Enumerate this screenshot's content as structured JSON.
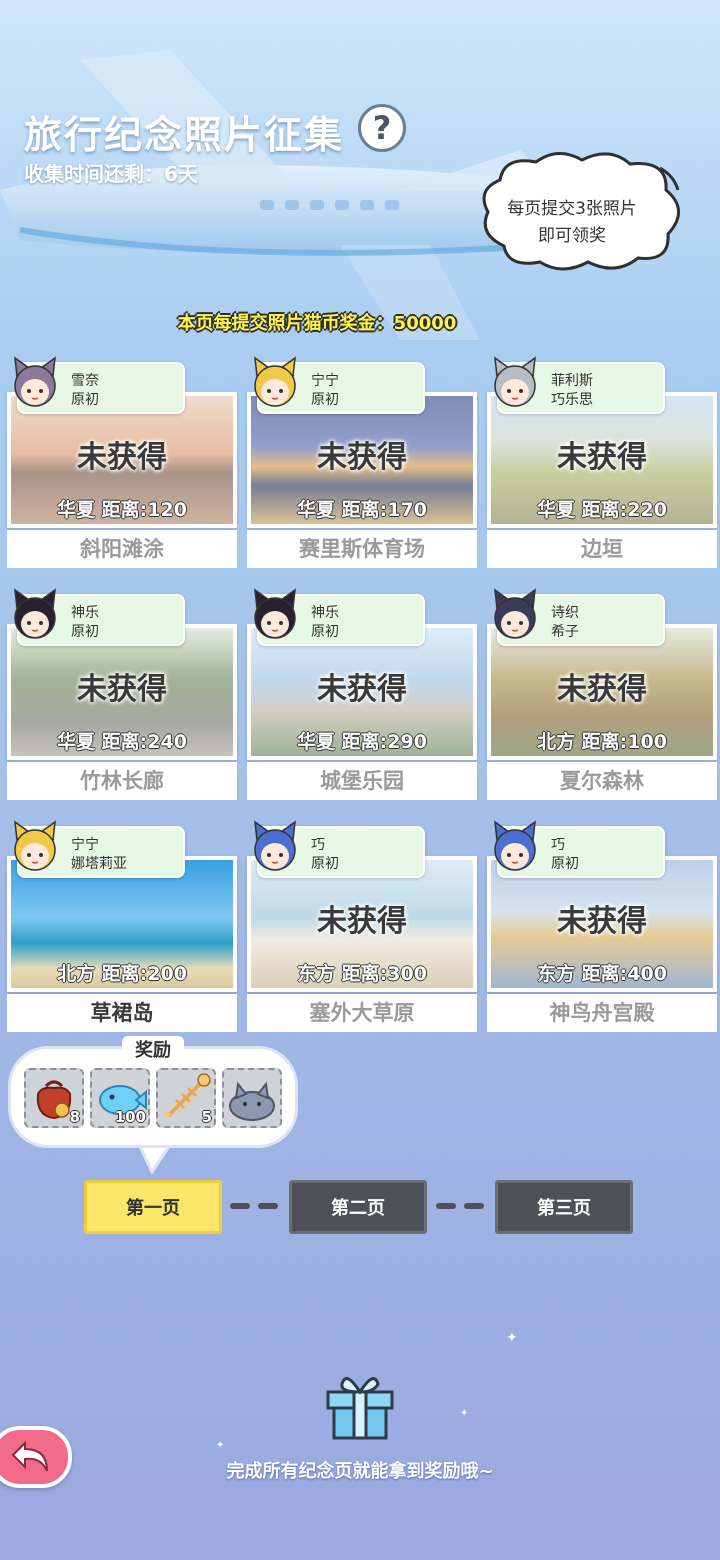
{
  "header": {
    "title": "旅行纪念照片征集",
    "help_symbol": "?",
    "countdown": "收集时间还剩：6天"
  },
  "bubble": {
    "line1": "每页提交3张照片",
    "line2": "即可领奖"
  },
  "bonus_text": "本页每提交照片猫币奖金：50000",
  "cards": [
    {
      "status": "未获得",
      "meta": "华夏  距离:120",
      "name": "斜阳滩涂",
      "tag1": "雪奈",
      "tag2": "原初",
      "owned": false
    },
    {
      "status": "未获得",
      "meta": "华夏  距离:170",
      "name": "赛里斯体育场",
      "tag1": "宁宁",
      "tag2": "原初",
      "owned": false
    },
    {
      "status": "未获得",
      "meta": "华夏  距离:220",
      "name": "边垣",
      "tag1": "菲利斯",
      "tag2": "巧乐思",
      "owned": false
    },
    {
      "status": "未获得",
      "meta": "华夏  距离:240",
      "name": "竹林长廊",
      "tag1": "神乐",
      "tag2": "原初",
      "owned": false
    },
    {
      "status": "未获得",
      "meta": "华夏  距离:290",
      "name": "城堡乐园",
      "tag1": "神乐",
      "tag2": "原初",
      "owned": false
    },
    {
      "status": "未获得",
      "meta": "北方  距离:100",
      "name": "夏尔森林",
      "tag1": "诗织",
      "tag2": "希子",
      "owned": false
    },
    {
      "status": "",
      "meta": "北方  距离:200",
      "name": "草裙岛",
      "tag1": "宁宁",
      "tag2": "娜塔莉亚",
      "owned": true
    },
    {
      "status": "未获得",
      "meta": "东方  距离:300",
      "name": "塞外大草原",
      "tag1": "巧",
      "tag2": "原初",
      "owned": false
    },
    {
      "status": "未获得",
      "meta": "东方  距离:400",
      "name": "神鸟舟宫殿",
      "tag1": "巧",
      "tag2": "原初",
      "owned": false
    }
  ],
  "rewards": {
    "label": "奖励",
    "items": [
      {
        "icon": "coin-bag-icon",
        "count": "8"
      },
      {
        "icon": "blue-fish-icon",
        "count": "100"
      },
      {
        "icon": "fish-bone-icon",
        "count": "5"
      },
      {
        "icon": "cat-plush-icon",
        "count": ""
      }
    ]
  },
  "pages": [
    {
      "label": "第一页",
      "active": true
    },
    {
      "label": "第二页",
      "active": false
    },
    {
      "label": "第三页",
      "active": false
    }
  ],
  "footer_text": "完成所有纪念页就能拿到奖励哦~",
  "colors": {
    "active_page": "#fbe66a",
    "inactive_page": "#4d5157",
    "bonus_text": "#fff34a",
    "back_button": "#f26b8a"
  }
}
